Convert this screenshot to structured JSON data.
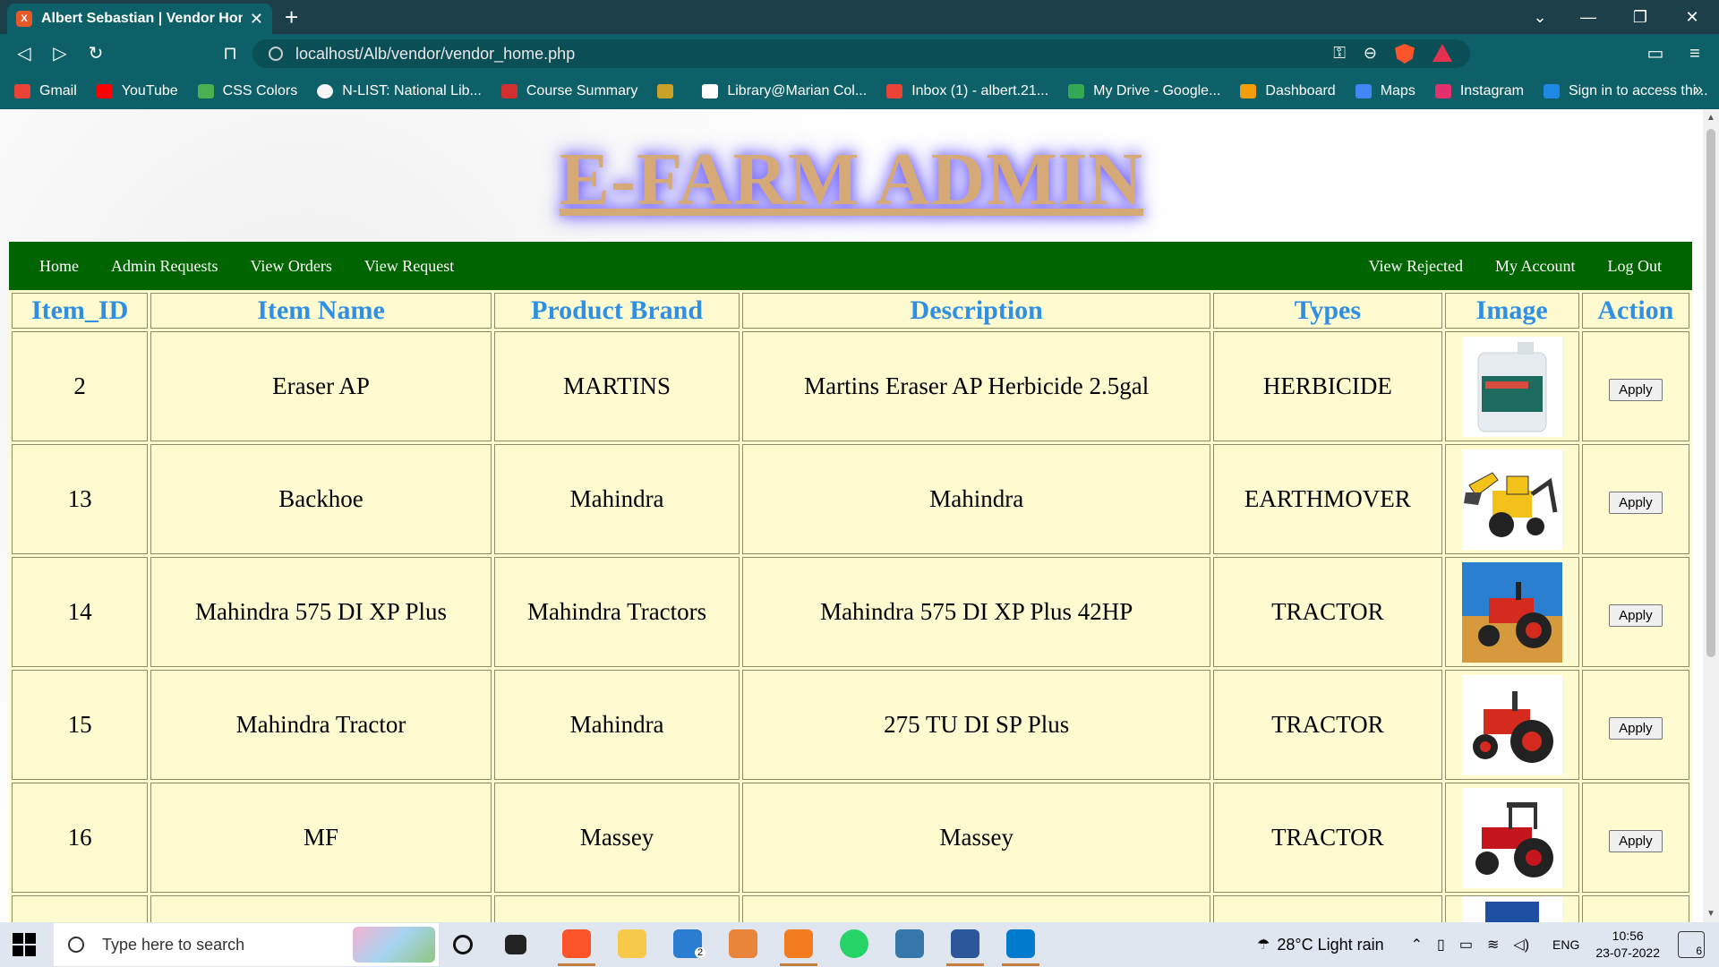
{
  "browser": {
    "tab_title": "Albert Sebastian | Vendor Home",
    "url": "localhost/Alb/vendor/vendor_home.php",
    "bookmarks": [
      {
        "label": "Gmail",
        "color": "#ea4335"
      },
      {
        "label": "YouTube",
        "color": "#ff0000"
      },
      {
        "label": "CSS Colors",
        "color": "#4caf50"
      },
      {
        "label": "N-LIST: National Lib...",
        "color": "#f5f5f5"
      },
      {
        "label": "Course Summary",
        "color": "#d32f2f"
      },
      {
        "label": "",
        "color": "#c9a227"
      },
      {
        "label": "Library@Marian Col...",
        "color": "#ffffff"
      },
      {
        "label": "Inbox (1) - albert.21...",
        "color": "#ea4335"
      },
      {
        "label": "My Drive - Google...",
        "color": "#34a853"
      },
      {
        "label": "Dashboard",
        "color": "#f59e0b"
      },
      {
        "label": "Maps",
        "color": "#4285f4"
      },
      {
        "label": "Instagram",
        "color": "#e1306c"
      },
      {
        "label": "Sign in to access thi...",
        "color": "#1e88e5"
      }
    ]
  },
  "page": {
    "title": "E-FARM ADMIN",
    "nav_left": [
      "Home",
      "Admin Requests",
      "View Orders",
      "View Request"
    ],
    "nav_right": [
      "View Rejected",
      "My Account",
      "Log Out"
    ],
    "table_headers": [
      "Item_ID",
      "Item Name",
      "Product Brand",
      "Description",
      "Types",
      "Image",
      "Action"
    ],
    "rows": [
      {
        "id": "2",
        "name": "Eraser AP",
        "brand": "MARTINS",
        "description": "Martins Eraser AP Herbicide 2.5gal",
        "type": "HERBICIDE",
        "image": "herbicide-jug",
        "action": "Apply"
      },
      {
        "id": "13",
        "name": "Backhoe",
        "brand": "Mahindra",
        "description": "Mahindra",
        "type": "EARTHMOVER",
        "image": "backhoe",
        "action": "Apply"
      },
      {
        "id": "14",
        "name": "Mahindra 575 DI XP Plus",
        "brand": "Mahindra Tractors",
        "description": "Mahindra 575 DI XP Plus 42HP",
        "type": "TRACTOR",
        "image": "red-tractor-field",
        "action": "Apply"
      },
      {
        "id": "15",
        "name": "Mahindra Tractor",
        "brand": "Mahindra",
        "description": "275 TU DI SP Plus",
        "type": "TRACTOR",
        "image": "red-tractor",
        "action": "Apply"
      },
      {
        "id": "16",
        "name": "MF",
        "brand": "Massey",
        "description": "Massey",
        "type": "TRACTOR",
        "image": "massey-tractor",
        "action": "Apply"
      }
    ]
  },
  "taskbar": {
    "search_placeholder": "Type here to search",
    "weather": "28°C  Light rain",
    "language": "ENG",
    "time": "10:56",
    "date": "23-07-2022",
    "notifications": "6",
    "mail_badge": "2"
  }
}
